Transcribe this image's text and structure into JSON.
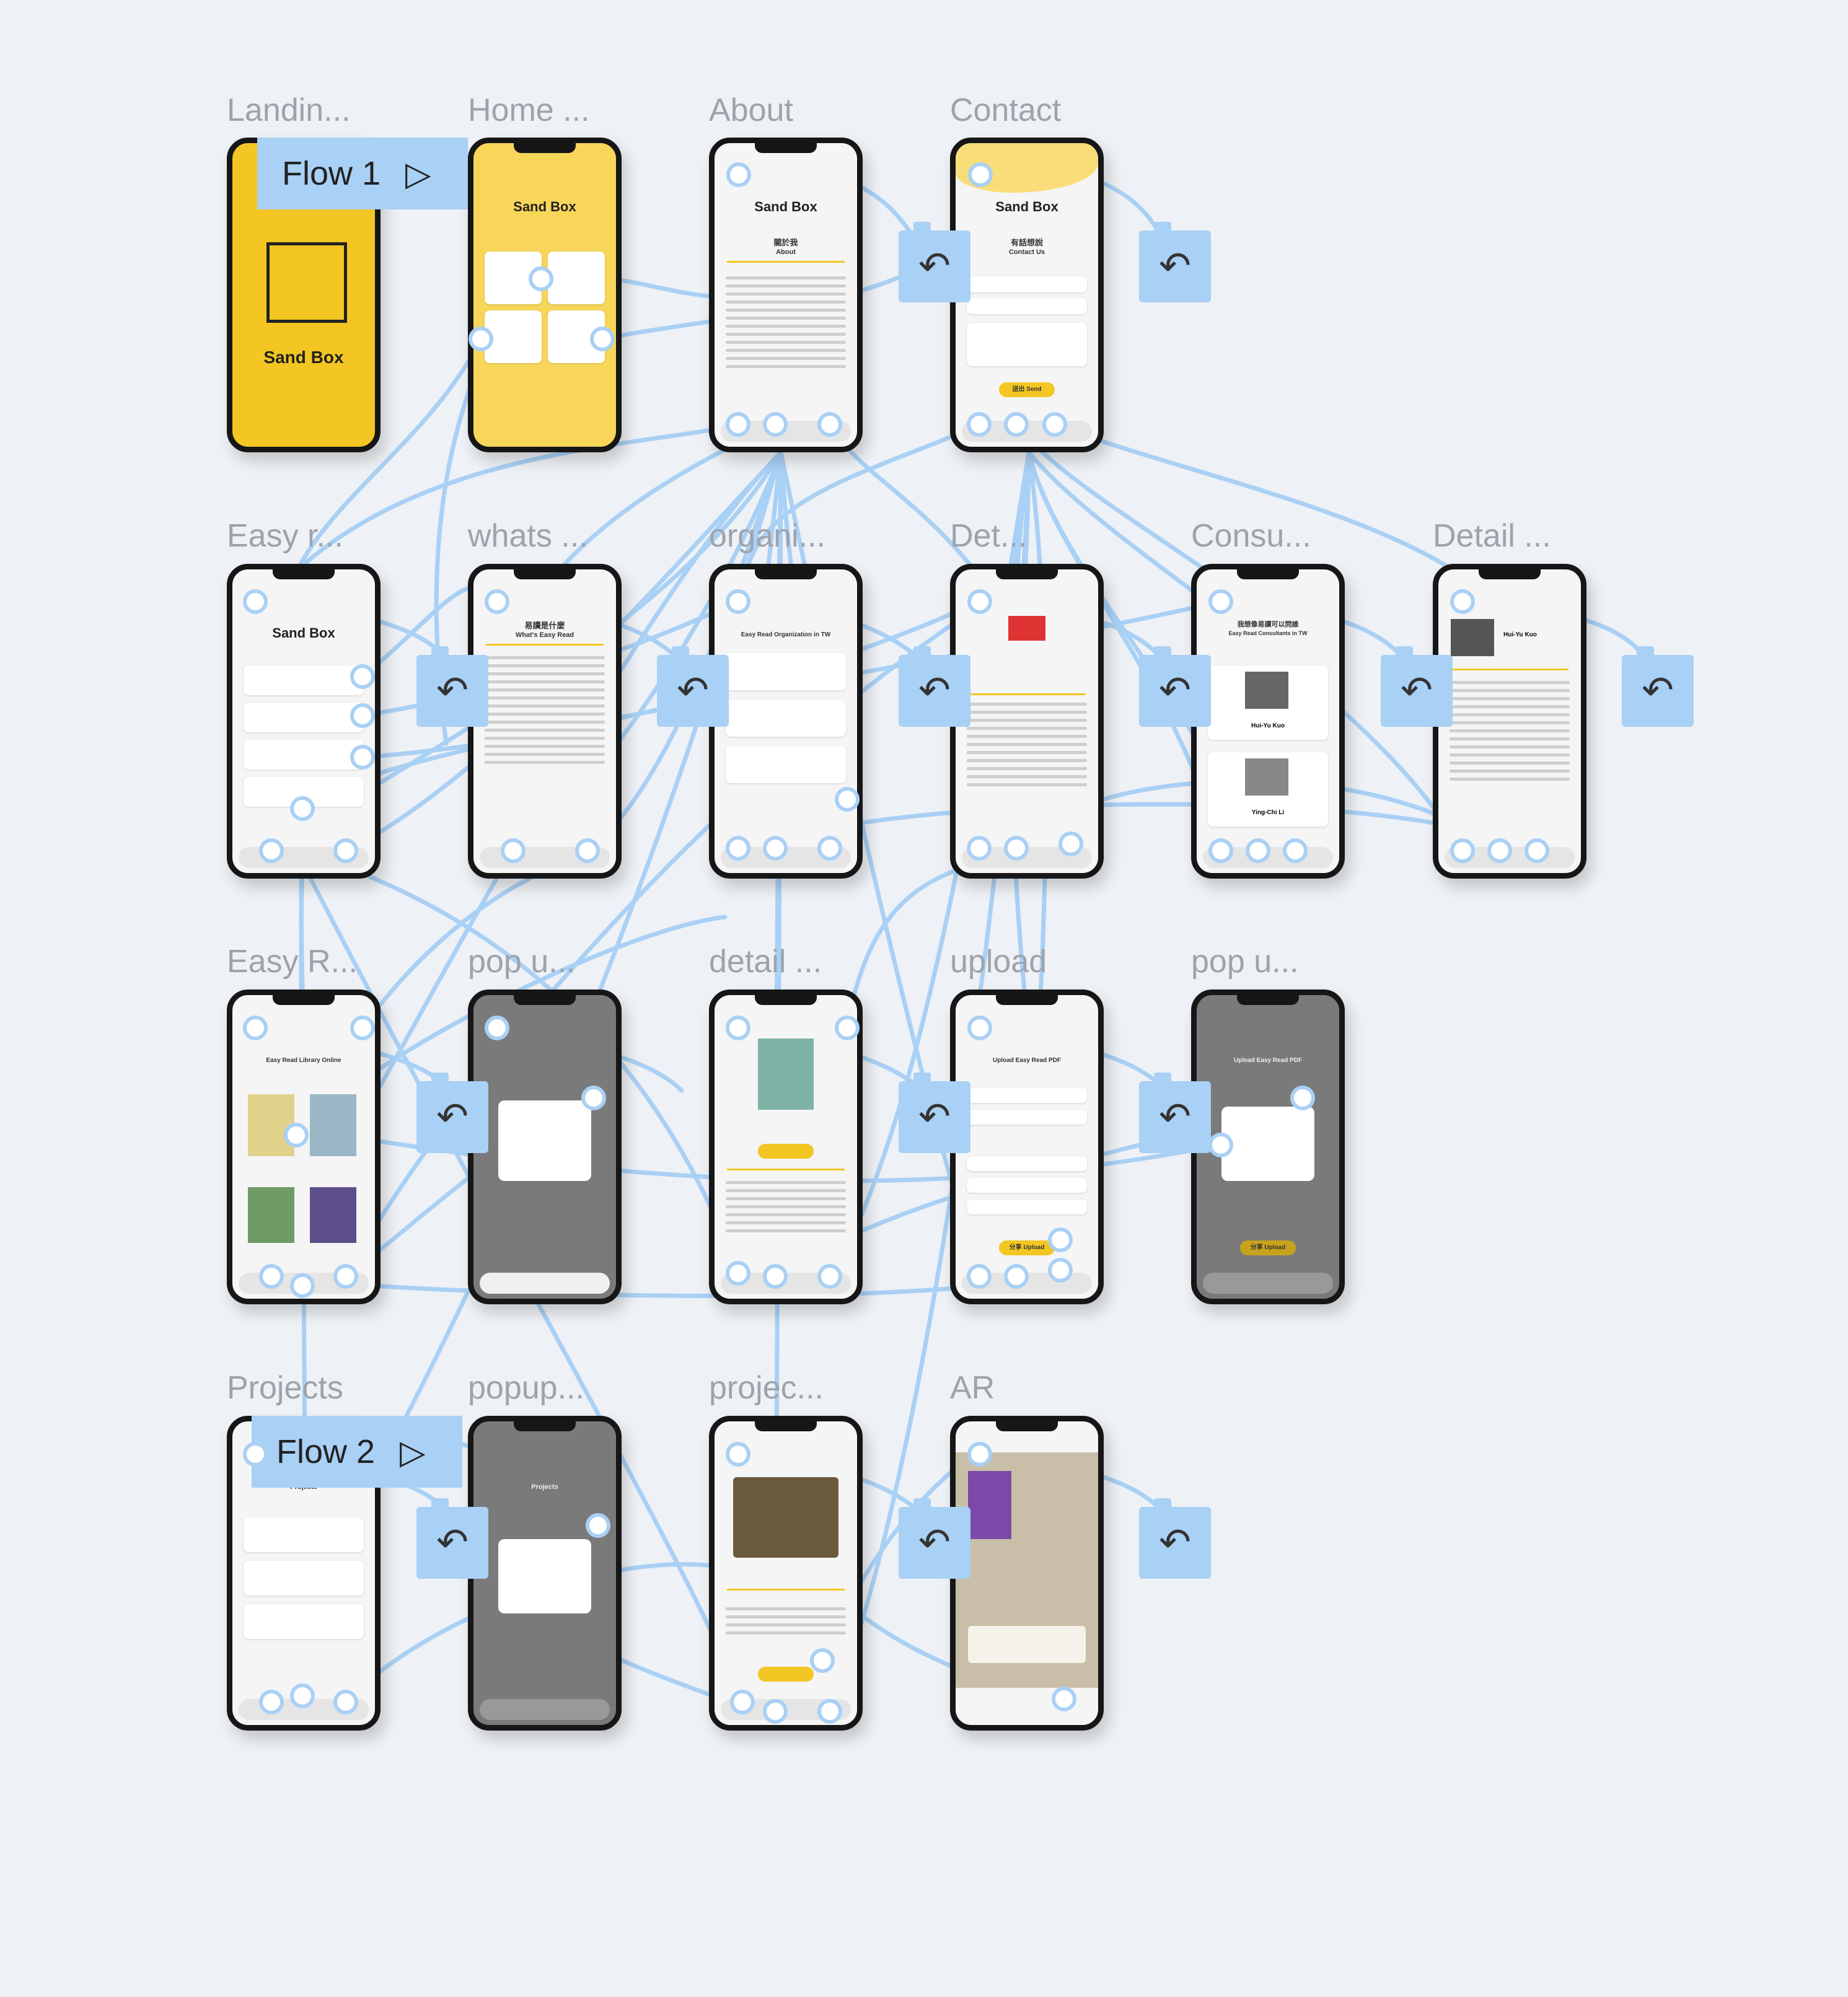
{
  "canvas": {
    "background": "#eef1f5",
    "connector_color": "#a9d0f5",
    "accent_color": "#f3c623"
  },
  "flows": [
    {
      "label": "Flow 1"
    },
    {
      "label": "Flow 2"
    }
  ],
  "frames": [
    {
      "title": "Landin...",
      "kind": "landing",
      "brand": "Sand Box"
    },
    {
      "title": "Home ...",
      "kind": "home",
      "brand": "Sand Box"
    },
    {
      "title": "About",
      "kind": "about",
      "brand": "Sand Box",
      "heading_zh": "關於我",
      "heading_en": "About"
    },
    {
      "title": "Contact",
      "kind": "contact",
      "brand": "Sand Box",
      "heading_zh": "有話想說",
      "heading_en": "Contact Us",
      "button": "送出 Send"
    },
    {
      "title": "Easy r...",
      "kind": "menu",
      "brand": "Sand Box"
    },
    {
      "title": "whats ...",
      "kind": "text",
      "heading_zh": "易讀是什麼",
      "heading_en": "What's Easy Read"
    },
    {
      "title": "organi...",
      "kind": "list",
      "heading_en": "Easy Read Organization in TW"
    },
    {
      "title": "Det...",
      "kind": "detail"
    },
    {
      "title": "Consu...",
      "kind": "consultants",
      "heading_zh": "我想像易讀可以問誰",
      "heading_en": "Easy Read Consultants in TW",
      "person1": "Hui-Yu Kuo",
      "person2": "Ying-Chi Li"
    },
    {
      "title": "Detail ...",
      "kind": "profile",
      "name": "Hui-Yu Kuo"
    },
    {
      "title": "Easy R...",
      "kind": "library",
      "heading_en": "Easy Read Library Online"
    },
    {
      "title": "pop u...",
      "kind": "popup-dark"
    },
    {
      "title": "detail ...",
      "kind": "book-detail"
    },
    {
      "title": "upload",
      "kind": "upload",
      "heading_en": "Upload Easy Read PDF",
      "button": "分享 Upload"
    },
    {
      "title": "pop u...",
      "kind": "popup-dark2",
      "heading_en": "Upload Easy Read PDF",
      "button": "分享 Upload"
    },
    {
      "title": "Projects",
      "kind": "projects",
      "heading_en": "Projects"
    },
    {
      "title": "popup...",
      "kind": "popup-dark3",
      "heading_en": "Projects"
    },
    {
      "title": "projec...",
      "kind": "project-detail"
    },
    {
      "title": "AR",
      "kind": "ar"
    }
  ],
  "back_icon": "undo-arrow-icon",
  "play_icon": "play-triangle-icon"
}
